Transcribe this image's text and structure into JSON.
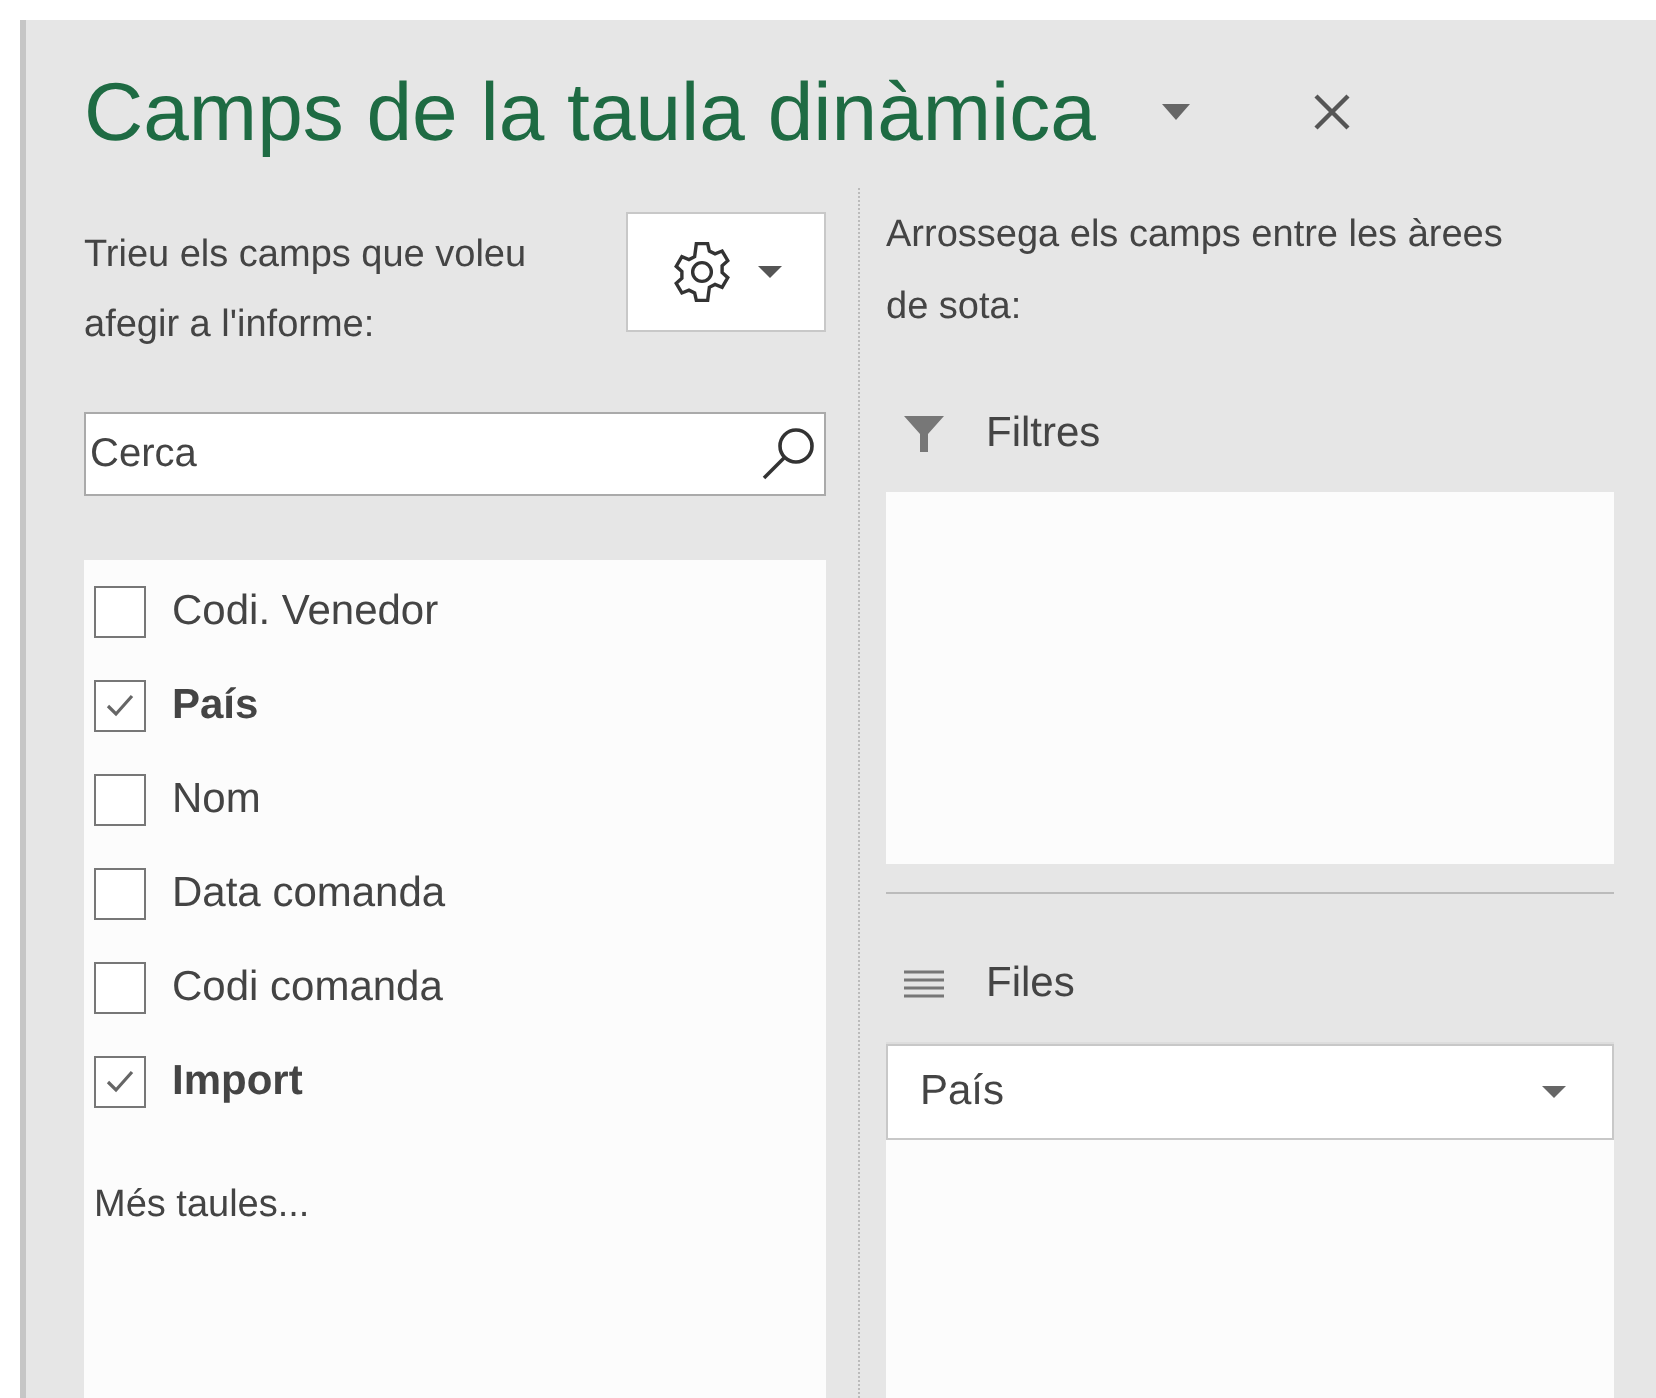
{
  "pane": {
    "title": "Camps de la taula dinàmica"
  },
  "left": {
    "instructions": "Trieu els camps que voleu afegir a l'informe:",
    "search": {
      "placeholder": "Cerca"
    },
    "fields": [
      {
        "label": "Codi. Venedor",
        "checked": false
      },
      {
        "label": "País",
        "checked": true
      },
      {
        "label": "Nom",
        "checked": false
      },
      {
        "label": "Data comanda",
        "checked": false
      },
      {
        "label": "Codi comanda",
        "checked": false
      },
      {
        "label": "Import",
        "checked": true
      }
    ],
    "more_tables": "Més taules..."
  },
  "right": {
    "instructions": "Arrossega els camps entre les àrees de sota:",
    "areas": [
      {
        "kind": "filter",
        "label": "Filtres"
      },
      {
        "kind": "rows",
        "label": "Files",
        "items": [
          "País"
        ]
      }
    ]
  }
}
